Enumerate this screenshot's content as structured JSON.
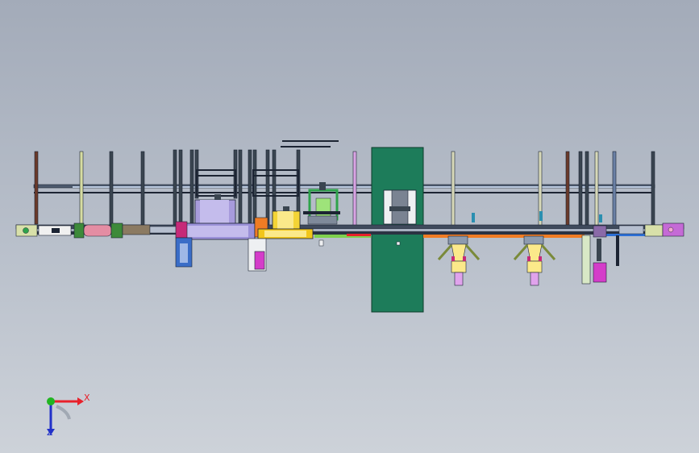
{
  "viewport": {
    "background_top": "#a3abb9",
    "background_bottom": "#cdd2d9"
  },
  "triad": {
    "x_label": "X",
    "z_label": "Z",
    "x_color": "#e8212b",
    "y_color": "#21b521",
    "z_color": "#2231c9"
  },
  "colors": {
    "frame": "#1c2433",
    "frame_fill": "#6c7689",
    "magenta": "#d9a4e4",
    "lavender": "#a79bdc",
    "yellow": "#f4d436",
    "green_panel": "#1d7c5a",
    "orange": "#f07c24",
    "blue_post": "#3a6dc7",
    "lime": "#7fd14d"
  }
}
